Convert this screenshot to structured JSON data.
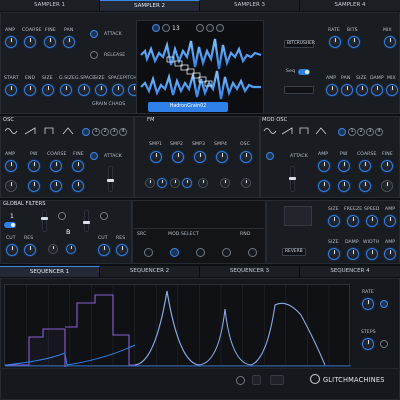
{
  "top_tabs": [
    {
      "label": "SAMPLER 1"
    },
    {
      "label": "SAMPLER 2"
    },
    {
      "label": "SAMPLER 3"
    },
    {
      "label": "SAMPLER 4"
    }
  ],
  "sampler": {
    "knobs_row1": [
      "AMP",
      "COARSE",
      "FINE",
      "PAN"
    ],
    "knobs_row2": [
      "START",
      "END",
      "SIZE",
      "G.SIZE",
      "G.SPACE",
      "SIZE",
      "SPACE",
      "PITCH"
    ],
    "attack_label": "ATTACK",
    "release_label": "RELEASE",
    "grain_chaos_label": "GRAIN CHAOS",
    "sample_counter": "13",
    "sample_name": "HadronGrain02",
    "right_knobs_row1": [
      "RATE",
      "BITS",
      "MIX"
    ],
    "right_knobs_row2": [
      "AMP",
      "PAN",
      "SIZE",
      "DAMP",
      "MIX"
    ],
    "fx_select": "BITCRUSHER",
    "seq_label": "Seq"
  },
  "osc_panel": {
    "title": "OSC",
    "knobs": [
      "AMP",
      "PW",
      "COARSE",
      "FINE"
    ],
    "attack_label": "ATTACK",
    "num_buttons": [
      "1",
      "2",
      "3",
      "4"
    ]
  },
  "fm_panel": {
    "title": "FM",
    "smp_labels": [
      "SMP1",
      "SMP2",
      "SMP3",
      "SMP4",
      "OSC"
    ]
  },
  "mod_osc_panel": {
    "title": "MOD OSC",
    "knobs": [
      "AMP",
      "PW",
      "COARSE",
      "FINE"
    ],
    "attack_label": "ATTACK",
    "num_buttons": [
      "1",
      "2",
      "3",
      "4"
    ]
  },
  "global_filters": {
    "title": "GLOBAL FILTERS",
    "filter_a_label": "1",
    "filter_b_label": "B",
    "knob_labels": [
      "CUT",
      "RES",
      "CUT",
      "RES"
    ]
  },
  "mod_select": {
    "src_label": "SRC",
    "title": "MOD SELECT",
    "rnd_label": "RND"
  },
  "reverb": {
    "knobs_row1": [
      "SIZE",
      "FREEZE",
      "SPEED",
      "AMP"
    ],
    "knobs_row2": [
      "SIZE",
      "DAMP",
      "WIDTH",
      "AMP"
    ],
    "select": "REVERB"
  },
  "seq_tabs": [
    {
      "label": "SEQUENCER 1"
    },
    {
      "label": "SEQUENCER 2"
    },
    {
      "label": "SEQUENCER 3"
    },
    {
      "label": "SEQUENCER 4"
    }
  ],
  "seq_side": {
    "rate_label": "RATE",
    "steps_label": "STEPS"
  },
  "brand": {
    "name": "GLITCHMACHINES"
  },
  "colors": {
    "accent": "#2f7fe9",
    "purple": "#8a5fd0",
    "background": "#0d0f12"
  }
}
